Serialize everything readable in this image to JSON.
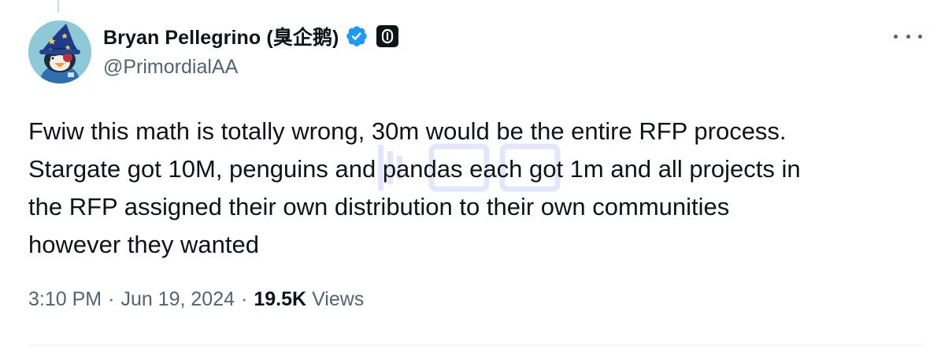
{
  "tweet": {
    "author": {
      "display_name": "Bryan Pellegrino (臭企鹅)",
      "handle": "@PrimordialAA",
      "verified": true,
      "verified_color": "#1d9bf0",
      "affiliation_icon": "layerzero-logo-icon"
    },
    "text": "Fwiw this math is totally wrong, 30m would be the entire RFP process.\nStargate got 10M, penguins and pandas each got 1m and all projects in\nthe RFP assigned their own distribution to their own communities\nhowever they wanted",
    "time": "3:10 PM",
    "separator": "·",
    "date": "Jun 19, 2024",
    "views_count": "19.5K",
    "views_label": "Views",
    "more_icon": "more-options-icon"
  },
  "colors": {
    "text_primary": "#0f1419",
    "text_secondary": "#536471",
    "accent": "#1d9bf0"
  }
}
